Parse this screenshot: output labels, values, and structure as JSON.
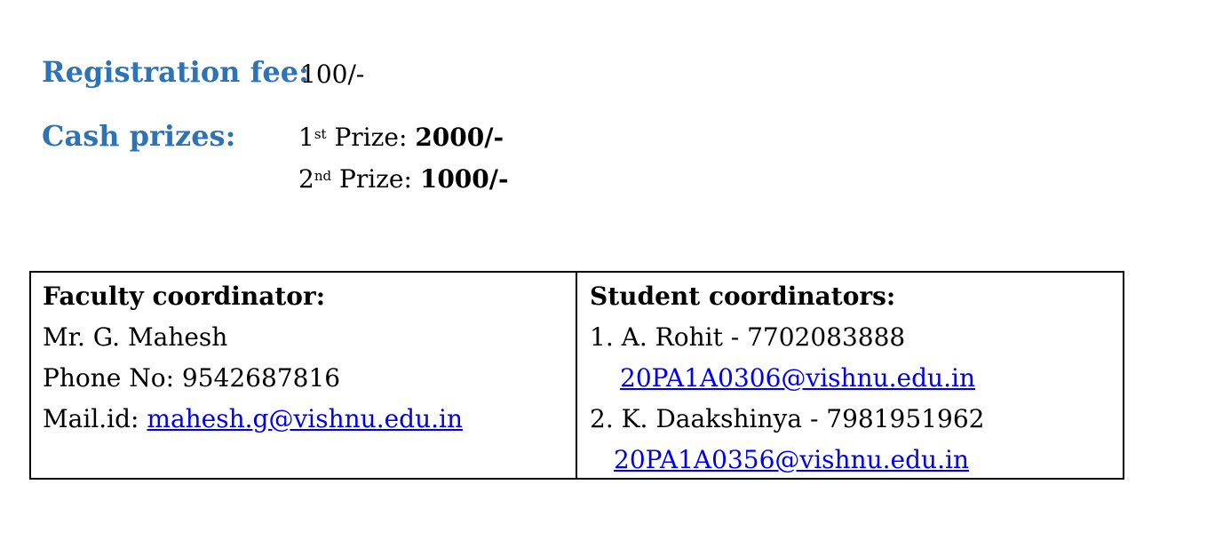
{
  "registration": {
    "label": "Registration fee:",
    "value": "100/-"
  },
  "cash_prizes": {
    "label": "Cash prizes:",
    "prizes": [
      {
        "number": "1",
        "ordinal": "st",
        "label": " Prize: ",
        "amount": "2000/-"
      },
      {
        "number": "2",
        "ordinal": "nd",
        "label": " Prize: ",
        "amount": "1000/-"
      }
    ]
  },
  "faculty": {
    "heading": "Faculty coordinator:",
    "name": "Mr. G. Mahesh",
    "phone": "Phone No: 9542687816",
    "mail_label": "Mail.id: ",
    "mail": "mahesh.g@vishnu.edu.in"
  },
  "students": {
    "heading": "Student coordinators:",
    "list": [
      {
        "entry": "1. A. Rohit - 7702083888",
        "email": "20PA1A0306@vishnu.edu.in"
      },
      {
        "entry": "2. K. Daakshinya - 7981951962",
        "email": "20PA1A0356@vishnu.edu.in"
      }
    ]
  },
  "colors": {
    "heading_blue": "#2e74b5",
    "link_blue": "#0000ee",
    "border": "#000000"
  }
}
